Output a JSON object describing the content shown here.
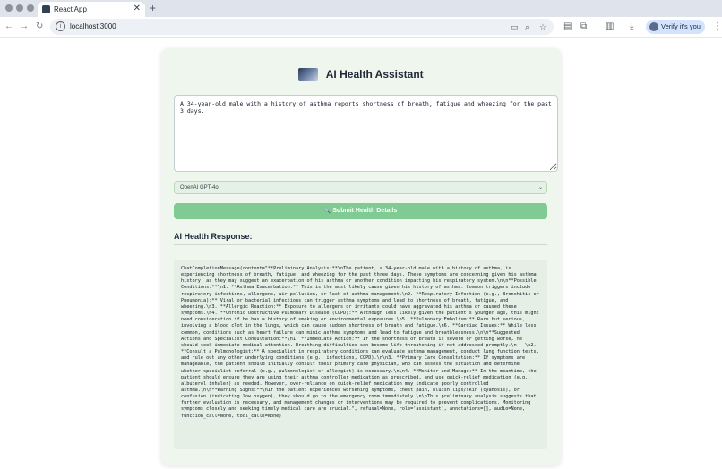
{
  "browser": {
    "tab_title": "React App",
    "tab_close": "✕",
    "new_tab": "+",
    "url": "localhost:3000",
    "verify_label": "Verify it's you"
  },
  "app": {
    "title": "AI Health Assistant",
    "symptoms_text": "A 34-year-old male with a history of asthma reports shortness of breath, fatigue and wheezing for the past 3 days.",
    "model_selected": "OpenAI GPT-4o",
    "submit_label": "Submit Health Details",
    "response_heading": "AI Health Response:",
    "response_text": "ChatCompletionMessage(content=\"**Preliminary Analysis:**\\nThe patient, a 34-year-old male with a history of asthma, is experiencing shortness of breath, fatigue, and wheezing for the past three days. These symptoms are concerning given his asthma history, as they may suggest an exacerbation of his asthma or another condition impacting his respiratory system.\\n\\n**Possible Conditions:**\\n1. **Asthma Exacerbation:** This is the most likely cause given his history of asthma. Common triggers include respiratory infections, allergens, air pollution, or lack of asthma management.\\n2. **Respiratory Infection (e.g., Bronchitis or Pneumonia):** Viral or bacterial infections can trigger asthma symptoms and lead to shortness of breath, fatigue, and wheezing.\\n3. **Allergic Reaction:** Exposure to allergens or irritants could have aggravated his asthma or caused these symptoms.\\n4. **Chronic Obstructive Pulmonary Disease (COPD):** Although less likely given the patient's younger age, this might need consideration if he has a history of smoking or environmental exposures.\\n5. **Pulmonary Embolism:** Rare but serious, involving a blood clot in the lungs, which can cause sudden shortness of breath and fatigue.\\n6. **Cardiac Issues:** While less common, conditions such as heart failure can mimic asthma symptoms and lead to fatigue and breathlessness.\\n\\n**Suggested Actions and Specialist Consultation:**\\n1. **Immediate Action:** If the shortness of breath is severe or getting worse, he should seek immediate medical attention. Breathing difficulties can become life-threatening if not addressed promptly.\\n   \\n2. **Consult a Pulmonologist:** A specialist in respiratory conditions can evaluate asthma management, conduct lung function tests, and rule out any other underlying conditions (e.g., infections, COPD).\\n\\n3. **Primary Care Consultation:** If symptoms are manageable, the patient should initially consult their primary care physician, who can assess the situation and determine whether specialist referral (e.g., pulmonologist or allergist) is necessary.\\n\\n4. **Monitor and Manage:** In the meantime, the patient should ensure they are using their asthma controller medication as prescribed, and use quick-relief medication (e.g., albuterol inhaler) as needed. However, over-reliance on quick-relief medication may indicate poorly controlled asthma.\\n\\n**Warning Signs:**\\nIf the patient experiences worsening symptoms, chest pain, bluish lips/skin (cyanosis), or confusion (indicating low oxygen), they should go to the emergency room immediately.\\n\\nThis preliminary analysis suggests that further evaluation is necessary, and management changes or interventions may be required to prevent complications. Monitoring symptoms closely and seeking timely medical care are crucial.\", refusal=None, role='assistant', annotations=[], audio=None, function_call=None, tool_calls=None)"
  },
  "colors": {
    "card_bg": "#eef6ee",
    "submit_bg": "#7fcb93",
    "select_bg": "#e4f1e4"
  }
}
